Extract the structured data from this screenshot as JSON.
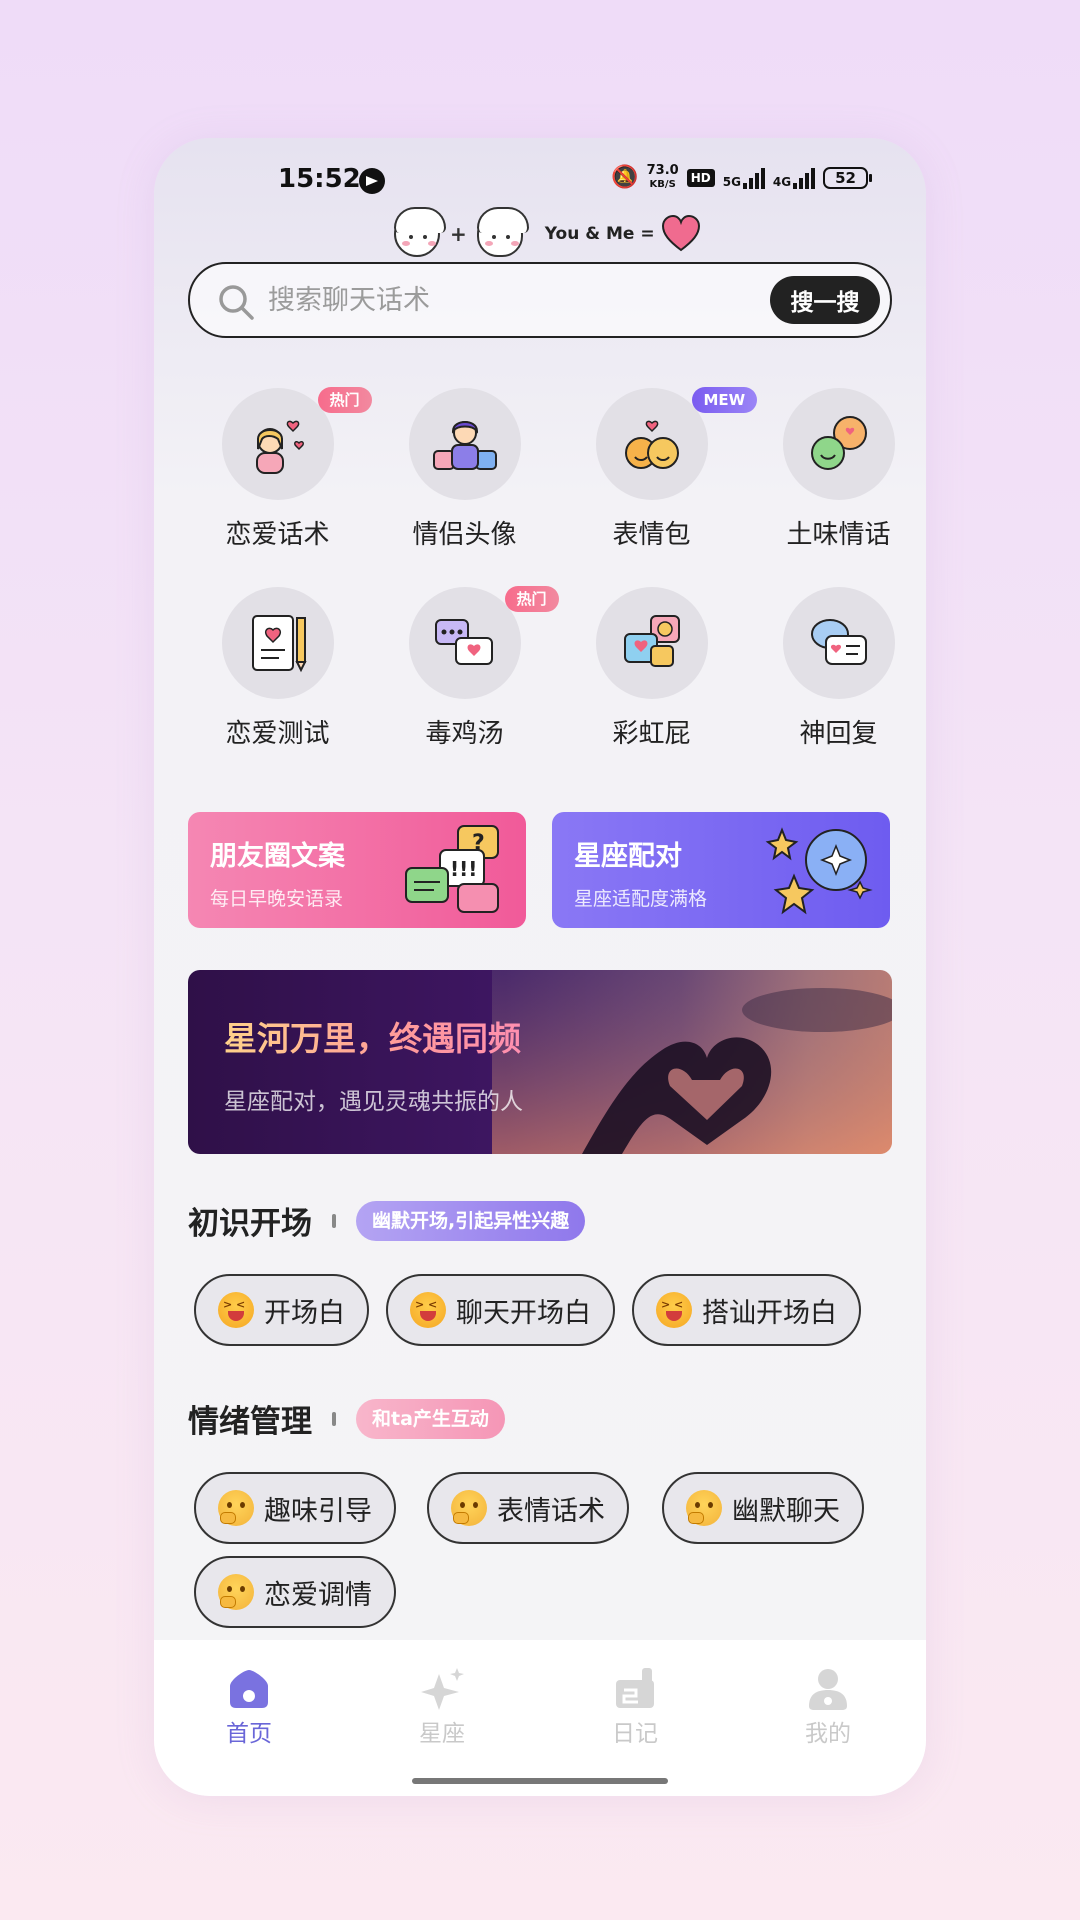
{
  "status_bar": {
    "time": "15:52",
    "net_speed_value": "73.0",
    "net_speed_unit": "KB/S",
    "hd_label": "HD",
    "signal1_label": "5G",
    "signal2_label": "4G",
    "battery": "52"
  },
  "logo": {
    "plus": "+",
    "text": "You & Me ="
  },
  "search": {
    "placeholder": "搜索聊天话术",
    "button_label": "搜一搜"
  },
  "categories": [
    {
      "label": "恋爱话术",
      "badge": "热门",
      "icon": "girl-hearts-icon"
    },
    {
      "label": "情侣头像",
      "badge": "",
      "icon": "couple-avatar-icon"
    },
    {
      "label": "表情包",
      "badge": "MEW",
      "icon": "emoji-faces-icon"
    },
    {
      "label": "土味情话",
      "badge": "",
      "icon": "chat-bubbles-icon"
    },
    {
      "label": "恋爱测试",
      "badge": "",
      "icon": "notebook-pencil-icon"
    },
    {
      "label": "毒鸡汤",
      "badge": "热门",
      "icon": "message-heart-icon"
    },
    {
      "label": "彩虹屁",
      "badge": "",
      "icon": "chat-heart-smile-icon"
    },
    {
      "label": "神回复",
      "badge": "",
      "icon": "reply-card-icon"
    }
  ],
  "banners": [
    {
      "title": "朋友圈文案",
      "subtitle": "每日早晚安语录",
      "icon": "speech-bubbles-question-icon",
      "color": "#f15a99"
    },
    {
      "title": "星座配对",
      "subtitle": "星座适配度满格",
      "icon": "stars-planet-icon",
      "color": "#6e5cf0"
    }
  ],
  "hero": {
    "title": "星河万里，终遇同频",
    "subtitle": "星座配对，遇见灵魂共振的人"
  },
  "sections": [
    {
      "title": "初识开场",
      "tag": "幽默开场,引起异性兴趣",
      "chips": [
        "开场白",
        "聊天开场白",
        "搭讪开场白"
      ]
    },
    {
      "title": "情绪管理",
      "tag": "和ta产生互动",
      "chips": [
        "趣味引导",
        "表情话术",
        "幽默聊天",
        "恋爱调情"
      ]
    }
  ],
  "tabbar": [
    {
      "label": "首页",
      "icon": "home-icon",
      "active": true
    },
    {
      "label": "星座",
      "icon": "sparkle-icon",
      "active": false
    },
    {
      "label": "日记",
      "icon": "diary-icon",
      "active": false
    },
    {
      "label": "我的",
      "icon": "user-icon",
      "active": false
    }
  ],
  "colors": {
    "accent": "#6a66d8",
    "hot_badge": "#f76c8c",
    "new_badge": "#7a5cf0"
  }
}
